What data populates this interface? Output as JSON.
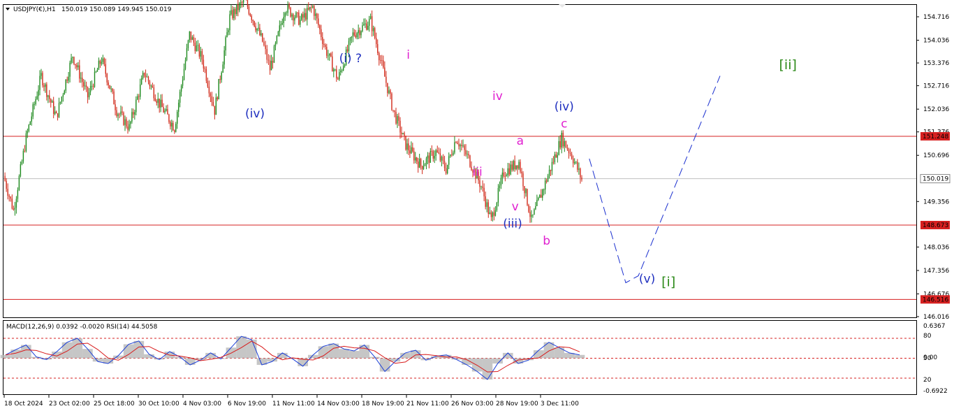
{
  "header": {
    "symbol_info": "USDJPY(€),H1",
    "ohlc": "150.019 150.089 149.945 150.019"
  },
  "indicator_header": "MACD(12,26,9) 0.0392 -0.0020 RSI(14) 44.5058",
  "colors": {
    "bull": "#1f8a1f",
    "bear": "#d12a1a",
    "level_line": "#d62020",
    "price_line": "#c0c0c0",
    "wave_blue": "#1f2fbf",
    "wave_magenta": "#e020d0",
    "wave_green": "#2d8a1a",
    "projection": "#1a2fcf",
    "rsi": "#1b3fd8",
    "signal": "#d81a1a",
    "macd_fill": "#b8b8b8",
    "level_label_bg": "#d62020",
    "price_label_bg": "#ffffff"
  },
  "chart_data": {
    "type": "candlestick",
    "timeframe": "H1",
    "x_tick_labels": [
      "18 Oct 2024",
      "23 Oct 02:00",
      "25 Oct 18:00",
      "30 Oct 10:00",
      "4 Nov 03:00",
      "6 Nov 19:00",
      "11 Nov 11:00",
      "14 Nov 03:00",
      "18 Nov 19:00",
      "21 Nov 11:00",
      "26 Nov 03:00",
      "28 Nov 19:00",
      "3 Dec 11:00"
    ],
    "y_tick_labels": [
      "154.716",
      "154.036",
      "153.376",
      "152.716",
      "152.036",
      "151.376",
      "150.696",
      "149.356",
      "148.036",
      "147.356",
      "146.676",
      "146.016"
    ],
    "ylim": [
      146.016,
      155.1
    ],
    "current_price": 150.019,
    "levels": [
      151.248,
      148.673,
      146.516
    ],
    "path": [
      [
        0,
        150.1
      ],
      [
        8,
        149.1
      ],
      [
        18,
        151.2
      ],
      [
        30,
        153.0
      ],
      [
        42,
        151.8
      ],
      [
        55,
        153.6
      ],
      [
        67,
        152.4
      ],
      [
        78,
        153.5
      ],
      [
        90,
        152.0
      ],
      [
        100,
        151.5
      ],
      [
        112,
        153.1
      ],
      [
        124,
        152.2
      ],
      [
        136,
        151.5
      ],
      [
        148,
        154.2
      ],
      [
        158,
        153.5
      ],
      [
        168,
        152.0
      ],
      [
        180,
        154.7
      ],
      [
        192,
        155.2
      ],
      [
        206,
        154.0
      ],
      [
        212,
        153.2
      ],
      [
        224,
        155.0
      ],
      [
        236,
        154.6
      ],
      [
        246,
        155.0
      ],
      [
        256,
        153.8
      ],
      [
        266,
        152.9
      ],
      [
        278,
        154.2
      ],
      [
        292,
        154.6
      ],
      [
        310,
        152.0
      ],
      [
        320,
        151.0
      ],
      [
        332,
        150.4
      ],
      [
        344,
        150.8
      ],
      [
        352,
        150.3
      ],
      [
        360,
        151.2
      ],
      [
        370,
        150.6
      ],
      [
        380,
        149.8
      ],
      [
        388,
        148.8
      ],
      [
        398,
        150.2
      ],
      [
        410,
        150.5
      ],
      [
        420,
        148.8
      ],
      [
        432,
        150.0
      ],
      [
        444,
        151.2
      ],
      [
        452,
        150.7
      ],
      [
        460,
        150.0
      ]
    ],
    "projection": [
      [
        466,
        150.6
      ],
      [
        495,
        147.0
      ],
      [
        505,
        147.2
      ],
      [
        570,
        153.0
      ]
    ],
    "wave_labels": [
      {
        "text": "(iv)",
        "x": 200,
        "price": 151.8,
        "color": "blue"
      },
      {
        "text": "(i) ?",
        "x": 276,
        "price": 153.4,
        "color": "blue"
      },
      {
        "text": "i",
        "x": 322,
        "price": 153.5,
        "color": "magenta"
      },
      {
        "text": "iv",
        "x": 393,
        "price": 152.3,
        "color": "magenta"
      },
      {
        "text": "iii",
        "x": 377,
        "price": 150.1,
        "color": "magenta"
      },
      {
        "text": "a",
        "x": 411,
        "price": 151.0,
        "color": "magenta"
      },
      {
        "text": "v",
        "x": 407,
        "price": 149.1,
        "color": "magenta"
      },
      {
        "text": "(iii)",
        "x": 405,
        "price": 148.6,
        "color": "blue"
      },
      {
        "text": "(iv)",
        "x": 446,
        "price": 152.0,
        "color": "blue"
      },
      {
        "text": "c",
        "x": 446,
        "price": 151.5,
        "color": "magenta"
      },
      {
        "text": "b",
        "x": 432,
        "price": 148.1,
        "color": "magenta"
      },
      {
        "text": "(v)",
        "x": 512,
        "price": 147.0,
        "color": "blue"
      },
      {
        "text": "[i]",
        "x": 529,
        "price": 146.9,
        "color": "green"
      },
      {
        "text": "[ii]",
        "x": 624,
        "price": 153.2,
        "color": "green"
      }
    ],
    "indicator": {
      "macd": 0.0392,
      "signal": -0.002,
      "rsi": 44.5058,
      "right_labels": [
        "0.6367",
        "80",
        "0.00",
        "50",
        "20",
        "-0.6922"
      ],
      "rsi_levels": [
        80,
        50,
        20
      ],
      "rsi_series": [
        55,
        63,
        70,
        52,
        48,
        60,
        74,
        80,
        64,
        45,
        42,
        54,
        71,
        76,
        56,
        48,
        60,
        52,
        40,
        47,
        58,
        49,
        66,
        83,
        78,
        40,
        45,
        58,
        49,
        38,
        55,
        68,
        72,
        64,
        61,
        70,
        52,
        30,
        45,
        58,
        62,
        47,
        53,
        55,
        48,
        40,
        30,
        18,
        42,
        58,
        42,
        47,
        62,
        74,
        66,
        58,
        55
      ]
    }
  }
}
